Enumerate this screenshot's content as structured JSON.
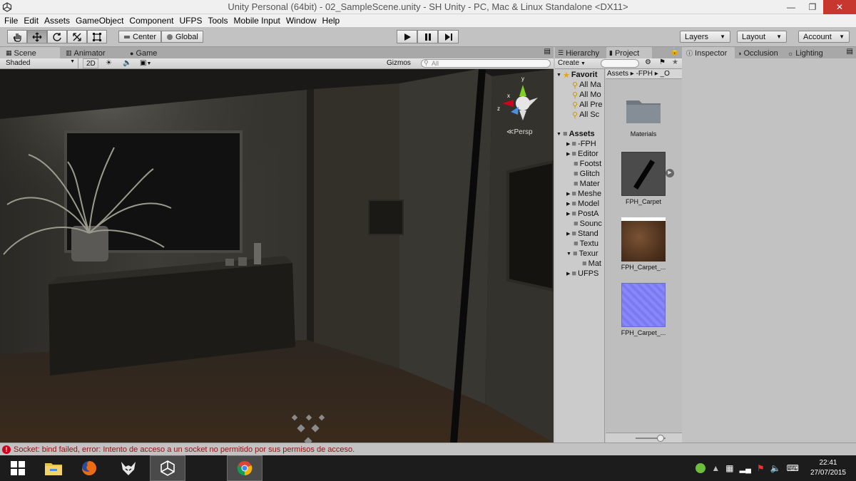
{
  "window": {
    "title": "Unity Personal (64bit) - 02_SampleScene.unity - SH Unity - PC, Mac & Linux Standalone <DX11>"
  },
  "menu": [
    "File",
    "Edit",
    "Assets",
    "GameObject",
    "Component",
    "UFPS",
    "Tools",
    "Mobile Input",
    "Window",
    "Help"
  ],
  "toolbar": {
    "pivot": "Center",
    "space": "Global",
    "layers": "Layers",
    "layout": "Layout",
    "account": "Account"
  },
  "scene_panel": {
    "tabs": [
      "Scene",
      "Animator",
      "Game"
    ],
    "shading": "Shaded",
    "mode_2d": "2D",
    "gizmos": "Gizmos",
    "search_placeholder": "All",
    "persp": "Persp"
  },
  "project_panel": {
    "tabs": [
      "Hierarchy",
      "Project"
    ],
    "create": "Create",
    "favorites": {
      "label": "Favorit",
      "items": [
        "All Ma",
        "All Mo",
        "All Pre",
        "All Sc"
      ]
    },
    "assets": {
      "label": "Assets",
      "items": [
        "-FPH",
        "Editor",
        "Footst",
        "Glitch",
        "Mater",
        "Meshe",
        "Model",
        "PostA",
        "Sounc",
        "Stand",
        "Textu",
        "Texur",
        "Mat",
        "UFPS"
      ]
    },
    "breadcrumb": [
      "Assets",
      "-FPH",
      "_O"
    ],
    "grid_assets": [
      {
        "label": "Materials",
        "kind": "folder"
      },
      {
        "label": "FPH_Carpet",
        "kind": "model"
      },
      {
        "label": "FPH_Carpet_...",
        "kind": "texture-brown"
      },
      {
        "label": "FPH_Carpet_...",
        "kind": "texture-normal"
      }
    ]
  },
  "inspector_panel": {
    "tabs": [
      "Inspector",
      "Occlusion",
      "Lighting"
    ]
  },
  "status": {
    "message": "Socket: bind failed, error: Intento de acceso a un socket no permitido por sus permisos de acceso."
  },
  "taskbar": {
    "time": "22:41",
    "date": "27/07/2015"
  },
  "colors": {
    "accent": "#c7372f",
    "panel": "#c2c2c2",
    "scene_bg": "#262521",
    "error": "#8b1414"
  }
}
